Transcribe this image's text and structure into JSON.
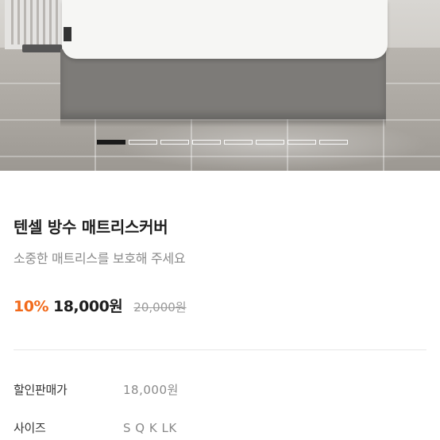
{
  "gallery": {
    "image": "mattress-cover-product-photo",
    "slide_count": 8,
    "active_slide": 1
  },
  "product": {
    "title": "텐셀 방수 매트리스커버",
    "subtitle": "소중한 매트리스를 보호해 주세요",
    "discount_rate": "10%",
    "sale_price": "18,000원",
    "original_price": "20,000원"
  },
  "specs": [
    {
      "label": "할인판매가",
      "value": "18,000원"
    },
    {
      "label": "사이즈",
      "value": "S Q K LK"
    }
  ],
  "colors": {
    "accent": "#f26a1b",
    "title": "#1f1f1f",
    "muted": "#8a8a8a"
  }
}
